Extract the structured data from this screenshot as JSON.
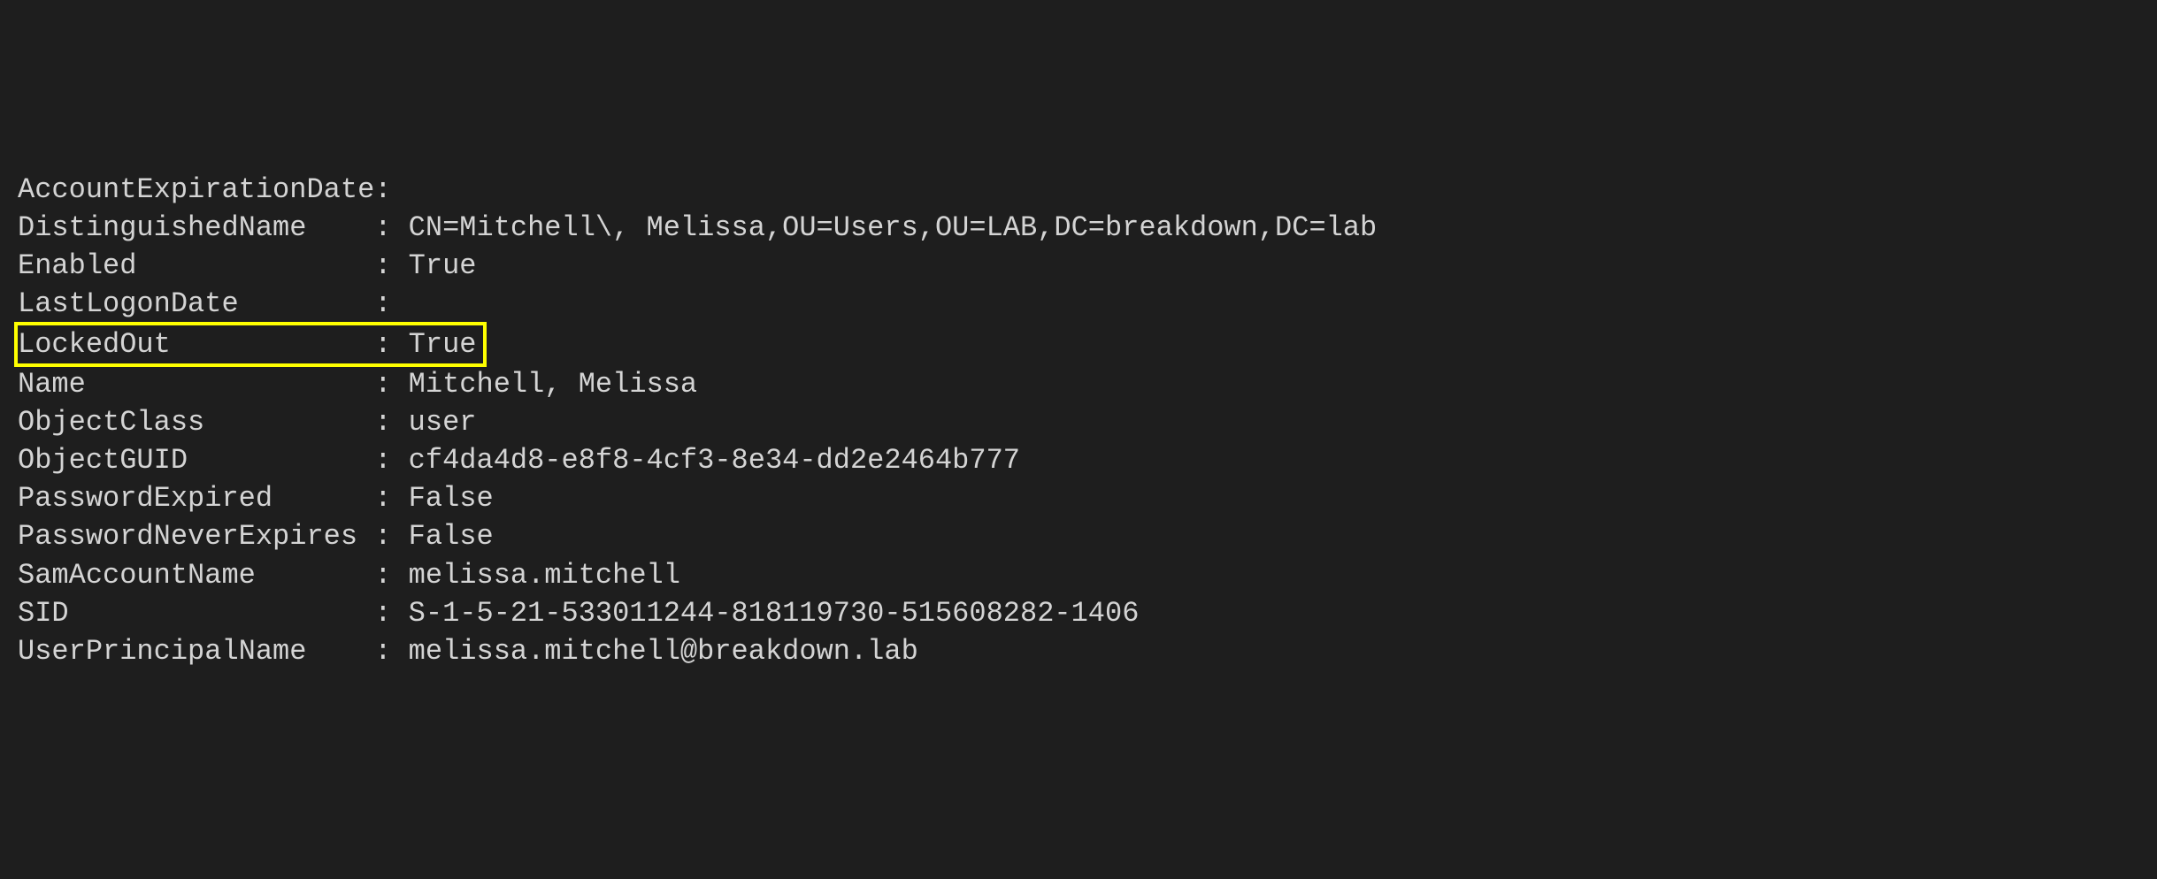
{
  "terminal": {
    "separator": ": ",
    "properties": [
      {
        "name": "AccountExpirationDate",
        "value": "",
        "highlighted": false
      },
      {
        "name": "DistinguishedName",
        "value": "CN=Mitchell\\, Melissa,OU=Users,OU=LAB,DC=breakdown,DC=lab",
        "highlighted": false
      },
      {
        "name": "Enabled",
        "value": "True",
        "highlighted": false
      },
      {
        "name": "LastLogonDate",
        "value": "",
        "highlighted": false
      },
      {
        "name": "LockedOut",
        "value": "True",
        "highlighted": true
      },
      {
        "name": "Name",
        "value": "Mitchell, Melissa",
        "highlighted": false
      },
      {
        "name": "ObjectClass",
        "value": "user",
        "highlighted": false
      },
      {
        "name": "ObjectGUID",
        "value": "cf4da4d8-e8f8-4cf3-8e34-dd2e2464b777",
        "highlighted": false
      },
      {
        "name": "PasswordExpired",
        "value": "False",
        "highlighted": false
      },
      {
        "name": "PasswordNeverExpires",
        "value": "False",
        "highlighted": false
      },
      {
        "name": "SamAccountName",
        "value": "melissa.mitchell",
        "highlighted": false
      },
      {
        "name": "SID",
        "value": "S-1-5-21-533011244-818119730-515608282-1406",
        "highlighted": false
      },
      {
        "name": "UserPrincipalName",
        "value": "melissa.mitchell@breakdown.lab",
        "highlighted": false
      }
    ]
  }
}
